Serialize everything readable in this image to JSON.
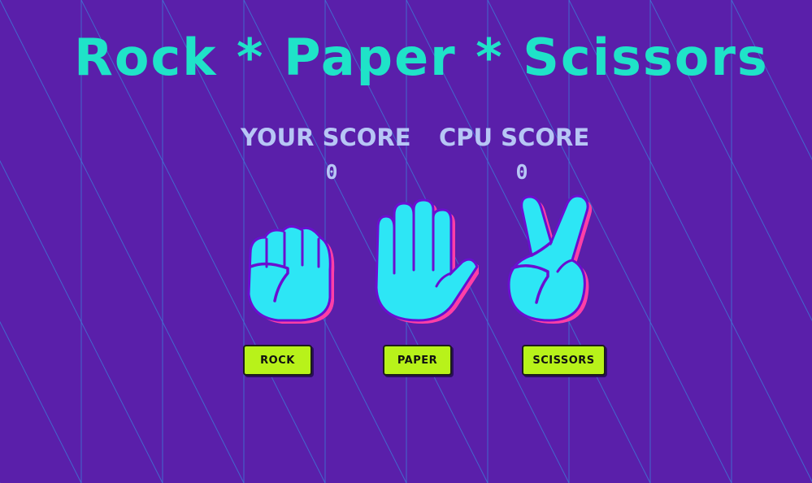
{
  "game": {
    "title": "Rock * Paper * Scissors"
  },
  "scores": {
    "you_label": "YOUR SCORE",
    "you_value": "0",
    "cpu_label": "CPU SCORE",
    "cpu_value": "0"
  },
  "choices": [
    {
      "icon": "fist-icon",
      "button_label": "ROCK"
    },
    {
      "icon": "open-hand-icon",
      "button_label": "PAPER"
    },
    {
      "icon": "victory-hand-icon",
      "button_label": "SCISSORS"
    }
  ],
  "colors": {
    "background": "#5a1faa",
    "title": "#1fe3c8",
    "score_text": "#b7c6f5",
    "hand_fill": "#2de6f5",
    "hand_outline": "#6a0fd0",
    "hand_shadow": "#ff3fa6",
    "button": "#b8f21a"
  }
}
